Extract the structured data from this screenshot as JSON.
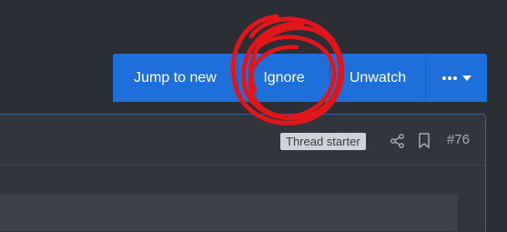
{
  "toolbar": {
    "jump_label": "Jump to new",
    "ignore_label": "Ignore",
    "unwatch_label": "Unwatch",
    "more_icon": "ellipsis-caret-icon"
  },
  "post": {
    "badge": "Thread starter",
    "number": "#76",
    "share_icon": "share-icon",
    "bookmark_icon": "bookmark-icon"
  },
  "colors": {
    "toolbar_bg": "#1f6fda",
    "page_bg": "#2b2e34",
    "badge_bg": "#cfd2d6",
    "annotation": "#e0161b"
  }
}
